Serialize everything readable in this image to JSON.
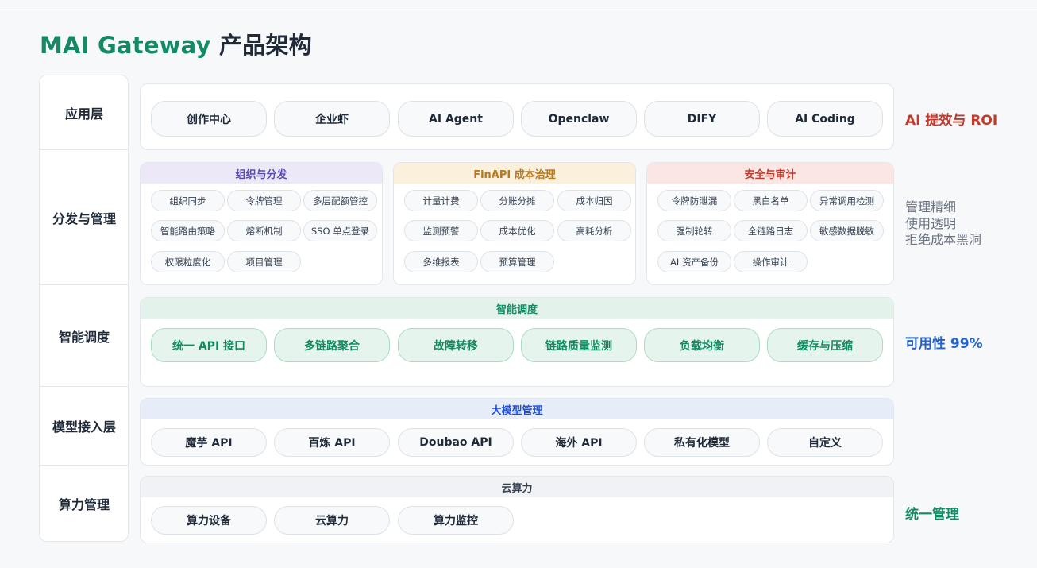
{
  "title": {
    "brand": "MAI Gateway",
    "rest": "产品架构"
  },
  "layers": [
    {
      "label": "应用层"
    },
    {
      "label": "分发与管理"
    },
    {
      "label": "智能调度"
    },
    {
      "label": "模型接入层"
    },
    {
      "label": "算力管理"
    }
  ],
  "app_layer": {
    "items": [
      "创作中心",
      "企业虾",
      "AI Agent",
      "Openclaw",
      "DIFY",
      "AI Coding"
    ]
  },
  "distribution": {
    "groups": [
      {
        "title": "组织与分发",
        "color": "#5b4bb5",
        "header_bg": "#ece8f8",
        "items": [
          "组织同步",
          "令牌管理",
          "多层配额管控",
          "智能路由策略",
          "熔断机制",
          "SSO 单点登录",
          "权限粒度化",
          "项目管理"
        ]
      },
      {
        "title": "FinAPI 成本治理",
        "color": "#b7791f",
        "header_bg": "#fbf0dc",
        "items": [
          "计量计费",
          "分账分摊",
          "成本归因",
          "监测预警",
          "成本优化",
          "高耗分析",
          "多维报表",
          "预算管理"
        ]
      },
      {
        "title": "安全与审计",
        "color": "#c0392b",
        "header_bg": "#fbe6e4",
        "items": [
          "令牌防泄漏",
          "黑白名单",
          "异常调用检测",
          "强制轮转",
          "全链路日志",
          "敏感数据脱敏",
          "AI 资产备份",
          "操作审计"
        ]
      }
    ]
  },
  "scheduling": {
    "title": "智能调度",
    "color": "#138a63",
    "header_bg": "#e3f3ec",
    "items": [
      "统一 API 接口",
      "多链路聚合",
      "故障转移",
      "链路质量监测",
      "负载均衡",
      "缓存与压缩"
    ]
  },
  "models": {
    "title": "大模型管理",
    "color": "#1d4ed8",
    "header_bg": "#e6edf9",
    "items": [
      "魔芋 API",
      "百炼 API",
      "Doubao API",
      "海外 API",
      "私有化模型",
      "自定义"
    ]
  },
  "compute": {
    "title": "云算力",
    "color": "#374151",
    "header_bg": "#f0f2f5",
    "items": [
      "算力设备",
      "云算力",
      "算力监控"
    ]
  },
  "notes": {
    "roi": {
      "text": "AI 提效与 ROI",
      "color": "#c0392b"
    },
    "mgmt": {
      "lines": [
        "管理精细",
        "使用透明",
        "拒绝成本黑洞"
      ],
      "color": "#6b7280"
    },
    "availability": {
      "text": "可用性 99%",
      "color": "#2563c9"
    },
    "unified": {
      "text": "统一管理",
      "color": "#138a63"
    }
  }
}
